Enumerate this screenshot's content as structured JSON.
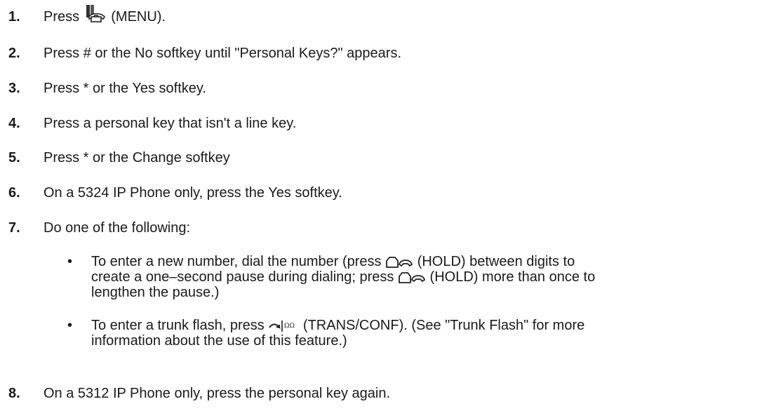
{
  "steps": [
    {
      "num": "1.",
      "pre": "Press",
      "post": "(MENU)."
    },
    {
      "num": "2.",
      "text": "Press # or the No softkey until \"Personal Keys?\" appears."
    },
    {
      "num": "3.",
      "text": "Press * or the Yes softkey."
    },
    {
      "num": "4.",
      "text": "Press a personal key that isn't a line key."
    },
    {
      "num": "5.",
      "text": "Press * or the Change softkey"
    },
    {
      "num": "6.",
      "text": "On a 5324 IP Phone only, press the Yes softkey."
    },
    {
      "num": "7.",
      "text": "Do one of the following:"
    },
    {
      "num": "8.",
      "text": "On a 5312 IP Phone only, press the personal key again."
    }
  ],
  "bullets": [
    {
      "l1_pre": "To enter a new number, dial the number (press",
      "l1_post": "(HOLD) between digits to",
      "l2_pre": "create a one–second pause during dialing; press",
      "l2_post": "(HOLD) more than once to",
      "l3": "lengthen the pause.)"
    },
    {
      "l1_pre": "To enter a trunk flash, press",
      "l1_post": "(TRANS/CONF). (See \"Trunk Flash\" for more",
      "l2": "information about the use of this feature.)"
    }
  ],
  "bullet_char": "•",
  "icons": {
    "menu": "menu-phone-icon",
    "hold": "hold-icon",
    "trans_conf": "trans-conf-icon"
  }
}
